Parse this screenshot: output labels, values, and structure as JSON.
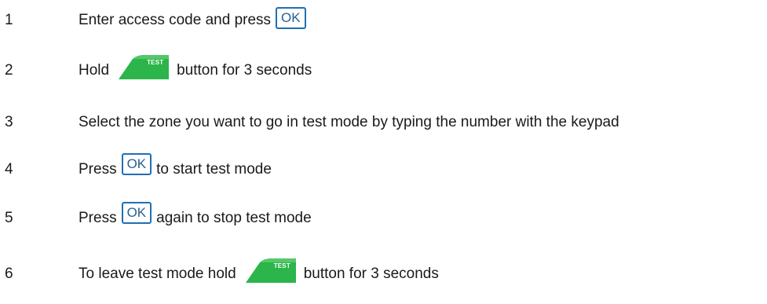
{
  "steps": [
    {
      "number": "1",
      "before": "Enter access code and press",
      "key": "OK",
      "after": ""
    },
    {
      "number": "2",
      "before": "Hold",
      "key": "TEST",
      "after": "button for 3 seconds"
    },
    {
      "number": "3",
      "before": "Select the zone you want to go in test mode by typing the number with the keypad",
      "key": "",
      "after": ""
    },
    {
      "number": "4",
      "before": "Press",
      "key": "OK",
      "after": "to start test mode"
    },
    {
      "number": "5",
      "before": "Press",
      "key": "OK",
      "after": "again to stop test mode"
    },
    {
      "number": "6",
      "before": "To leave test mode hold",
      "key": "TEST",
      "after": "button for 3 seconds"
    }
  ],
  "colors": {
    "ok_key_border": "#1f6fb5",
    "test_key_fill": "#2bb54a"
  },
  "icons": [
    "ok-key-icon",
    "test-key-icon"
  ]
}
